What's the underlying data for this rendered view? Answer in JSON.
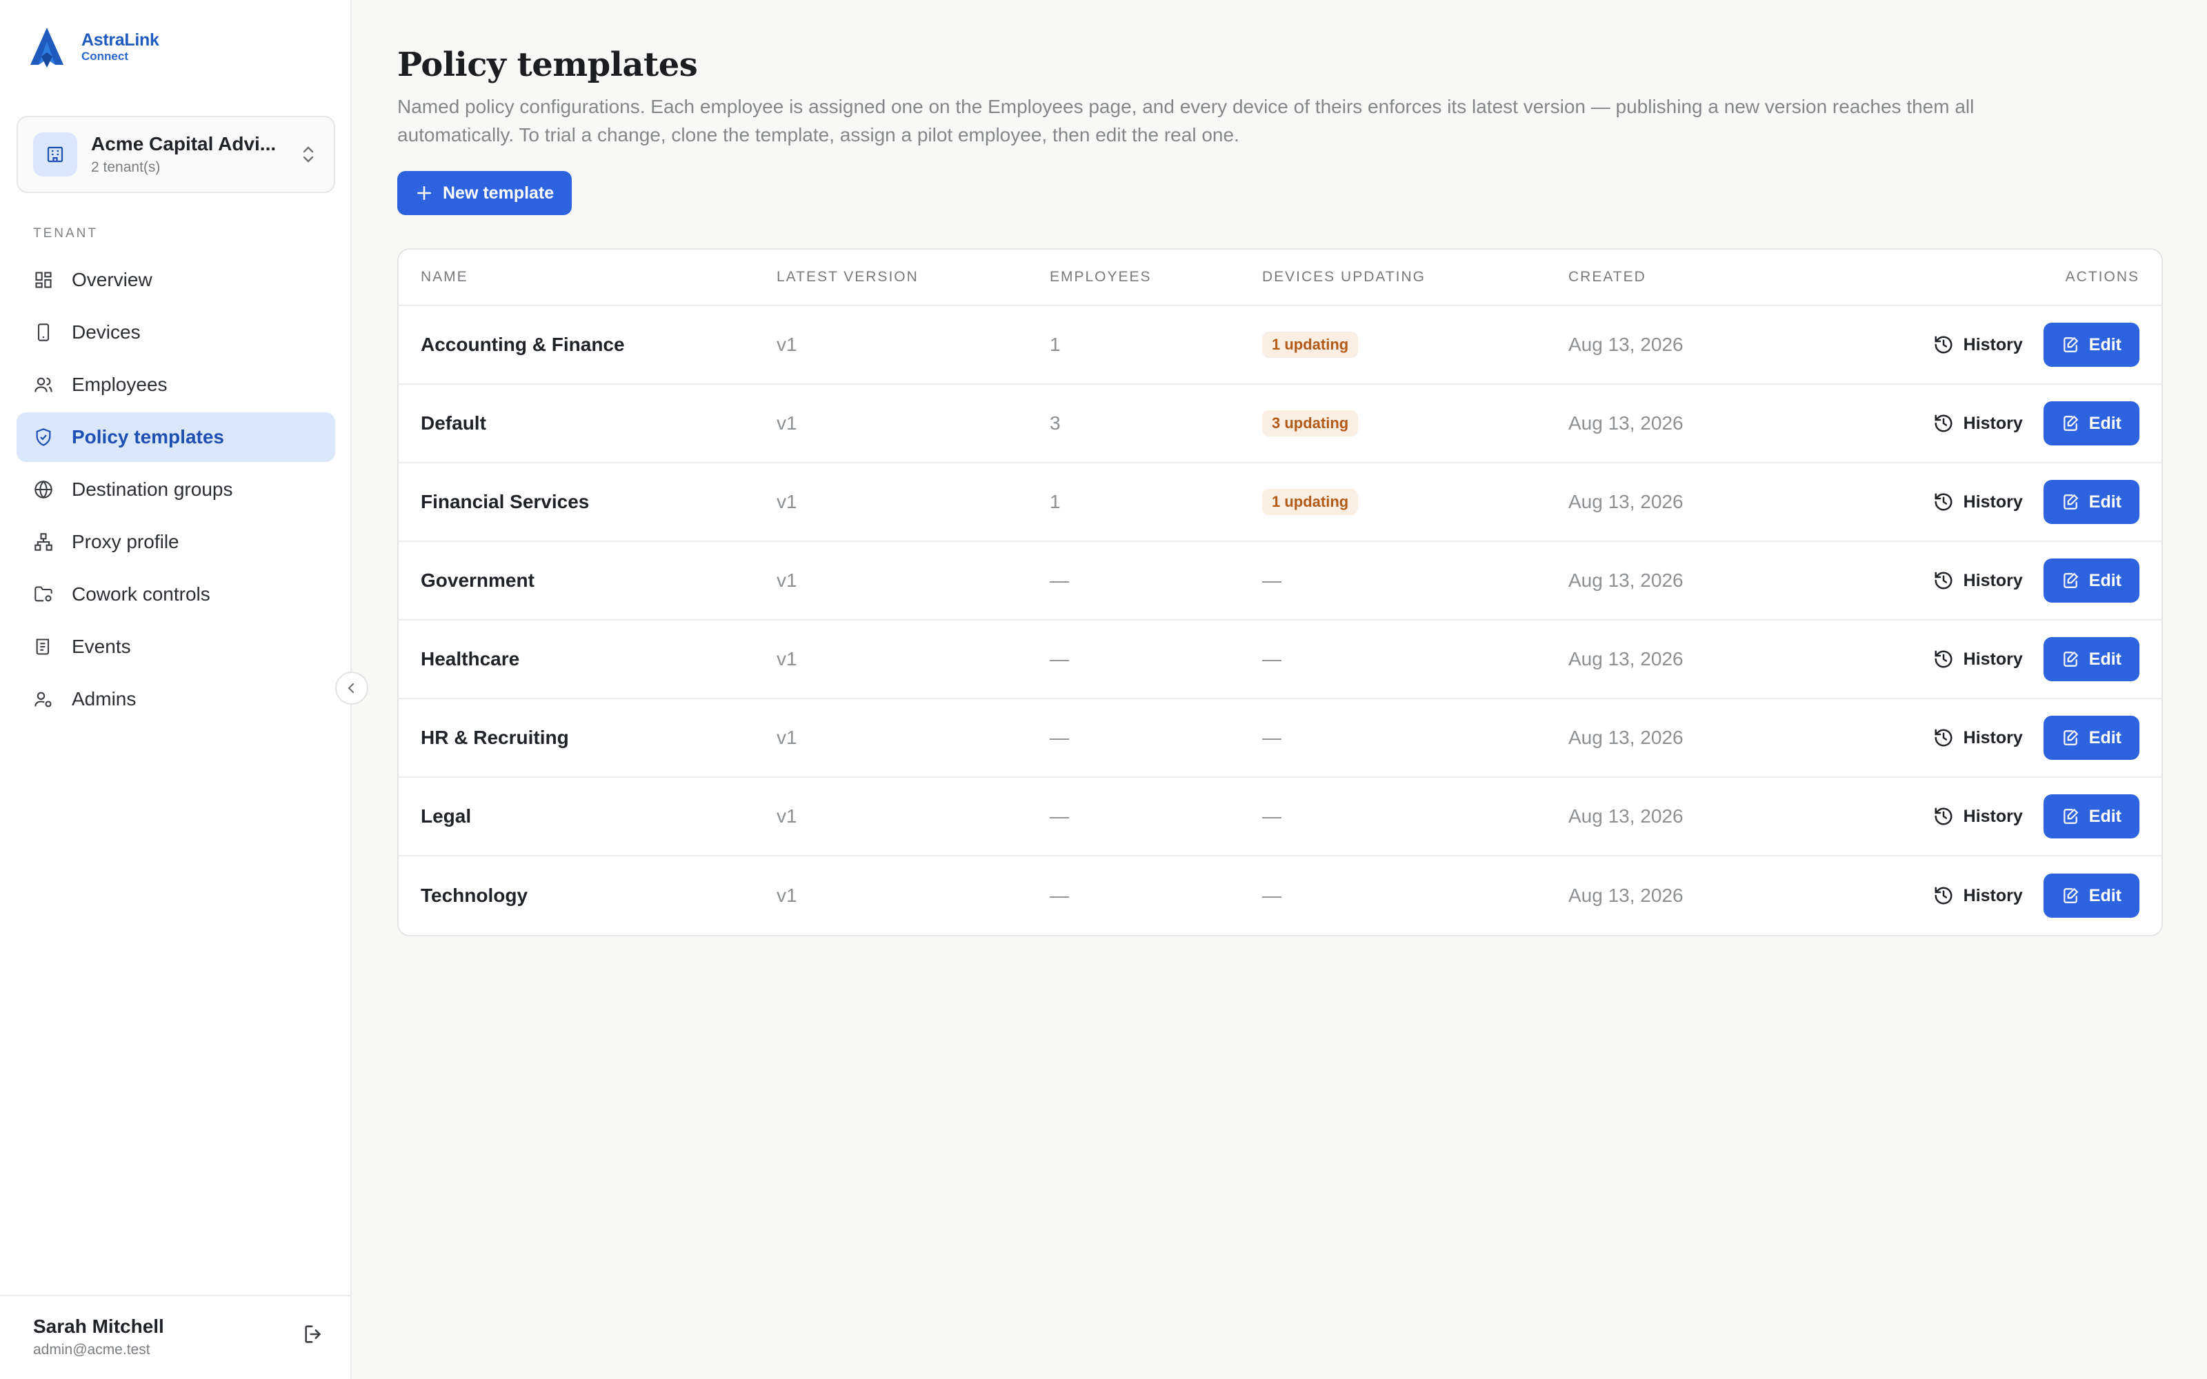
{
  "brand": {
    "name": "AstraLink",
    "sub": "Connect",
    "color": "#1f5bbf"
  },
  "tenant": {
    "name": "Acme Capital Advi...",
    "count": "2 tenant(s)"
  },
  "sidebar": {
    "section": "TENANT",
    "items": [
      {
        "label": "Overview",
        "icon": "dashboard-icon"
      },
      {
        "label": "Devices",
        "icon": "device-icon"
      },
      {
        "label": "Employees",
        "icon": "users-icon"
      },
      {
        "label": "Policy templates",
        "icon": "shield-icon",
        "active": true
      },
      {
        "label": "Destination groups",
        "icon": "globe-icon"
      },
      {
        "label": "Proxy profile",
        "icon": "network-icon"
      },
      {
        "label": "Cowork controls",
        "icon": "folder-gear-icon"
      },
      {
        "label": "Events",
        "icon": "scroll-icon"
      },
      {
        "label": "Admins",
        "icon": "admin-user-icon"
      }
    ]
  },
  "user": {
    "name": "Sarah Mitchell",
    "email": "admin@acme.test"
  },
  "page": {
    "title": "Policy templates",
    "description": "Named policy configurations. Each employee is assigned one on the Employees page, and every device of theirs enforces its latest version — publishing a new version reaches them all automatically. To trial a change, clone the template, assign a pilot employee, then edit the real one.",
    "new_button": "New template"
  },
  "table": {
    "headers": {
      "name": "NAME",
      "version": "LATEST VERSION",
      "employees": "EMPLOYEES",
      "devices": "DEVICES UPDATING",
      "created": "CREATED",
      "actions": "ACTIONS"
    },
    "history_label": "History",
    "edit_label": "Edit",
    "rows": [
      {
        "name": "Accounting & Finance",
        "version": "v1",
        "employees": "1",
        "devices": "1 updating",
        "devices_badge": true,
        "created": "Aug 13, 2026"
      },
      {
        "name": "Default",
        "version": "v1",
        "employees": "3",
        "devices": "3 updating",
        "devices_badge": true,
        "created": "Aug 13, 2026"
      },
      {
        "name": "Financial Services",
        "version": "v1",
        "employees": "1",
        "devices": "1 updating",
        "devices_badge": true,
        "created": "Aug 13, 2026"
      },
      {
        "name": "Government",
        "version": "v1",
        "employees": "—",
        "devices": "—",
        "devices_badge": false,
        "created": "Aug 13, 2026"
      },
      {
        "name": "Healthcare",
        "version": "v1",
        "employees": "—",
        "devices": "—",
        "devices_badge": false,
        "created": "Aug 13, 2026"
      },
      {
        "name": "HR & Recruiting",
        "version": "v1",
        "employees": "—",
        "devices": "—",
        "devices_badge": false,
        "created": "Aug 13, 2026"
      },
      {
        "name": "Legal",
        "version": "v1",
        "employees": "—",
        "devices": "—",
        "devices_badge": false,
        "created": "Aug 13, 2026"
      },
      {
        "name": "Technology",
        "version": "v1",
        "employees": "—",
        "devices": "—",
        "devices_badge": false,
        "created": "Aug 13, 2026"
      }
    ]
  },
  "colors": {
    "accent": "#2e63e0",
    "active_nav_bg": "#dbe8fb",
    "badge_bg": "#fbeee2",
    "badge_text": "#b25a18"
  }
}
